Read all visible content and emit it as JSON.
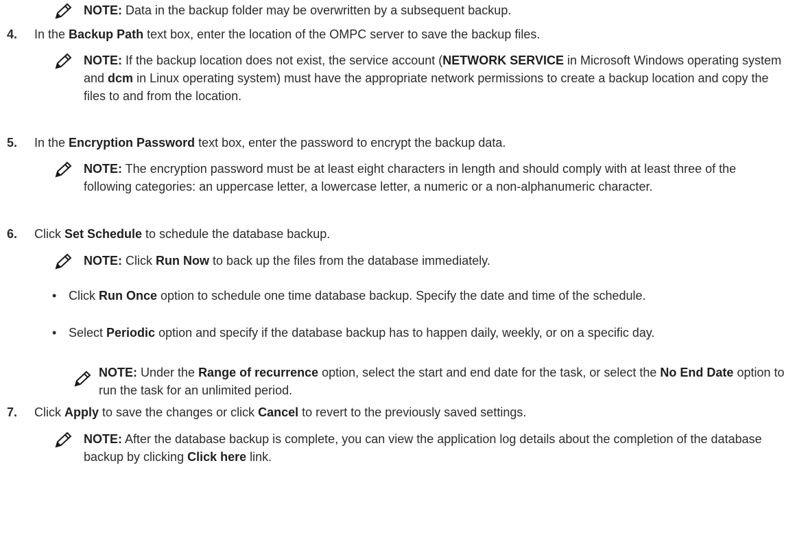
{
  "note_top": {
    "label": "NOTE:",
    "text": " Data in the backup folder may be overwritten by a subsequent backup."
  },
  "step4": {
    "number": "4.",
    "pre": "In the ",
    "bold": "Backup Path",
    "post": " text box, enter the location of the OMPC server to save the backup files.",
    "note": {
      "label": "NOTE:",
      "t1": " If the backup location does not exist, the service account (",
      "b1": "NETWORK SERVICE",
      "t2": " in Microsoft Windows operating system and ",
      "b2": "dcm",
      "t3": " in Linux operating system) must have the appropriate network permissions to create a backup location and copy the files to and from the location."
    }
  },
  "step5": {
    "number": "5.",
    "pre": "In the ",
    "bold": "Encryption Password",
    "post": " text box, enter the password to encrypt the backup data.",
    "note": {
      "label": "NOTE:",
      "text": " The encryption password must be at least eight characters in length and should comply with at least three of the following categories: an uppercase letter, a lowercase letter, a numeric or a non-alphanumeric character."
    }
  },
  "step6": {
    "number": "6.",
    "pre": "Click ",
    "bold": "Set Schedule",
    "post": " to schedule the database backup.",
    "note": {
      "label": "NOTE:",
      "t1": " Click ",
      "b1": "Run Now",
      "t2": " to back up the files from the database immediately."
    },
    "bullets": [
      {
        "dot": "•",
        "pre": "Click ",
        "bold": "Run Once",
        "post": " option to schedule one time database backup. Specify the date and time of the schedule."
      },
      {
        "dot": "•",
        "pre": "Select ",
        "bold": "Periodic",
        "post": " option and specify if the database backup has to happen daily, weekly, or on a specific day."
      }
    ],
    "sub_note": {
      "label": "NOTE:",
      "t1": " Under the ",
      "b1": "Range of recurrence",
      "t2": " option, select the start and end date for the task, or select the ",
      "b2": "No End Date",
      "t3": " option to run the task for an unlimited period."
    }
  },
  "step7": {
    "number": "7.",
    "pre": "Click ",
    "b1": "Apply",
    "mid": " to save the changes or click ",
    "b2": "Cancel",
    "post": " to revert to the previously saved settings.",
    "note": {
      "label": "NOTE:",
      "t1": " After the database backup is complete, you can view the application log details about the completion of the database backup by clicking ",
      "b1": "Click here",
      "t2": " link."
    }
  },
  "icons": {
    "note_icon": "pencil-icon",
    "icon_color": "#1a1a1a"
  }
}
